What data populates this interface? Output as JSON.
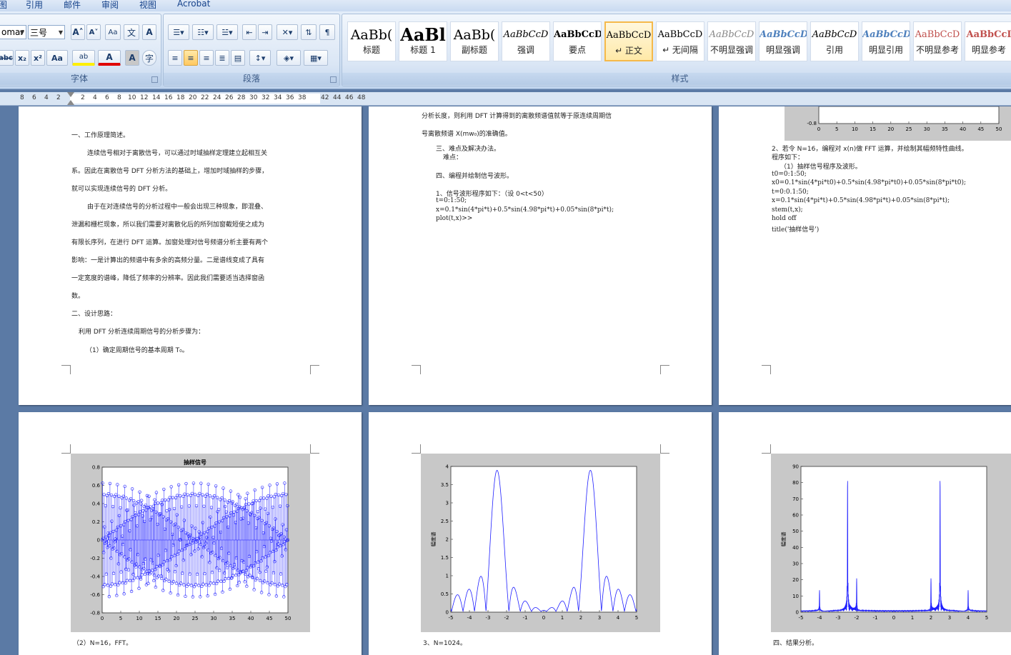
{
  "tabs": [
    "图",
    "引用",
    "邮件",
    "审阅",
    "视图",
    "Acrobat"
  ],
  "font_group": {
    "label": "字体",
    "font_name": "omar",
    "font_size": "三号",
    "grow": "A˄",
    "shrink": "A˅",
    "clear": "Aa",
    "phonetic": "文",
    "border_char": "A",
    "strike": "abc",
    "sub": "x₂",
    "sup": "x²",
    "case": "Aa",
    "highlight": "ab",
    "color": "A",
    "shade": "A",
    "enclose": "字"
  },
  "para_group": {
    "label": "段落"
  },
  "styles_group": {
    "label": "样式",
    "items": [
      {
        "sample": "AaBb(",
        "name": "标题",
        "size": 19,
        "weight": "normal",
        "color": "#000",
        "italic": false
      },
      {
        "sample": "AaBl",
        "name": "标题 1",
        "size": 24,
        "weight": "bold",
        "color": "#000",
        "italic": false
      },
      {
        "sample": "AaBb(",
        "name": "副标题",
        "size": 19,
        "weight": "normal",
        "color": "#000",
        "italic": false
      },
      {
        "sample": "AaBbCcD",
        "name": "强调",
        "size": 13,
        "weight": "normal",
        "color": "#000",
        "italic": true
      },
      {
        "sample": "AaBbCcD",
        "name": "要点",
        "size": 13,
        "weight": "bold",
        "color": "#000",
        "italic": false
      },
      {
        "sample": "AaBbCcD",
        "name": "↵ 正文",
        "size": 13,
        "weight": "normal",
        "color": "#000",
        "italic": false,
        "selected": true
      },
      {
        "sample": "AaBbCcD",
        "name": "↵ 无间隔",
        "size": 13,
        "weight": "normal",
        "color": "#000",
        "italic": false
      },
      {
        "sample": "AaBbCcD",
        "name": "不明显强调",
        "size": 13,
        "weight": "normal",
        "color": "#888",
        "italic": true
      },
      {
        "sample": "AaBbCcD",
        "name": "明显强调",
        "size": 13,
        "weight": "bold",
        "color": "#4f81bd",
        "italic": true
      },
      {
        "sample": "AaBbCcD",
        "name": "引用",
        "size": 13,
        "weight": "normal",
        "color": "#000",
        "italic": true
      },
      {
        "sample": "AaBbCcD",
        "name": "明显引用",
        "size": 13,
        "weight": "bold",
        "color": "#4f81bd",
        "italic": true
      },
      {
        "sample": "AaBbCcD",
        "name": "不明显参考",
        "size": 13,
        "weight": "normal",
        "color": "#c0504d",
        "italic": false
      },
      {
        "sample": "AaBbCcI",
        "name": "明显参考",
        "size": 13,
        "weight": "bold",
        "color": "#c0504d",
        "italic": false
      }
    ]
  },
  "ruler": {
    "numbers": [
      "8",
      "6",
      "4",
      "2",
      "2",
      "4",
      "6",
      "8",
      "10",
      "12",
      "14",
      "16",
      "18",
      "20",
      "22",
      "24",
      "26",
      "28",
      "30",
      "32",
      "34",
      "36",
      "38",
      "42",
      "44",
      "46",
      "48"
    ]
  },
  "page1": {
    "lines": [
      "一、工作原理简述。",
      "连续信号相对于离散信号，可以通过时域抽样定理建立起相互关",
      "系。因此在离散信号 DFT 分析方法的基础上，增加时域抽样的步骤，",
      "就可以实现连续信号的 DFT 分析。",
      "由于在对连续信号的分析过程中一般会出现三种现象，即混叠、",
      "泄漏和栅栏现象，所以我们需要对离散化后的所列加窗截短使之成为",
      "有限长序列，在进行 DFT 运算。加窗处理对信号频谱分析主要有两个",
      "影响：一是计算出的频谱中有多余的高频分量。二是谱线变成了具有",
      "一定宽度的谱峰，降低了频率的分辨率。因此我们需要适当选择窗函",
      "数。",
      "二、设计思路：",
      "利用 DFT 分析连续周期信号的分析步骤为：",
      "（1）确定周期信号的基本周期 T₀。"
    ]
  },
  "page2": {
    "lines": [
      "分析长度，则利用 DFT 计算得到的离散频谱值就等于原连续周期信",
      "号离散频谱 X(mw₀)的准确值。",
      "三、难点及解决办法。",
      "难点：",
      "四、编程并绘制信号波形。",
      "1、信号波形程序如下：（设 0<t<50）",
      "t=0:1:50;",
      "x=0.1*sin(4*pi*t)+0.5*sin(4.98*pi*t)+0.05*sin(8*pi*t);",
      "plot(t,x)>>"
    ]
  },
  "page3": {
    "lines": [
      "2、若令 N=16，编程对 x(n)做 FFT 运算，并绘制其幅频特性曲线。",
      "程序如下：",
      "（1）抽样信号程序及波形。",
      "t0=0:1:50;",
      "x0=0.1*sin(4*pi*t0)+0.5*sin(4.98*pi*t0)+0.05*sin(8*pi*t0);",
      "t=0:0.1:50;",
      "x=0.1*sin(4*pi*t)+0.5*sin(4.98*pi*t)+0.05*sin(8*pi*t);",
      "stem(t,x);",
      "hold off",
      "title('抽样信号')"
    ],
    "top_plot_x_ticks": [
      "0",
      "5",
      "10",
      "15",
      "20",
      "25",
      "30",
      "35",
      "40",
      "45",
      "50"
    ],
    "top_plot_y_label": "-0.8"
  },
  "page4": {
    "caption": "（2）N=16，FFT。"
  },
  "page5": {
    "caption": "3、N=1024。"
  },
  "page6": {
    "caption": "四、结果分析。"
  },
  "chart_data": [
    {
      "type": "scatter",
      "title": "抽样信号",
      "xlabel": "",
      "ylabel": "",
      "xlim": [
        0,
        50
      ],
      "ylim": [
        -0.8,
        0.8
      ],
      "x_ticks": [
        0,
        5,
        10,
        15,
        20,
        25,
        30,
        35,
        40,
        45,
        50
      ],
      "y_ticks": [
        -0.8,
        -0.6,
        -0.4,
        -0.2,
        0,
        0.2,
        0.4,
        0.6,
        0.8
      ],
      "series": [
        {
          "values": "x=0.1*sin(4*pi*t)+0.5*sin(4.98*pi*t)+0.05*sin(8*pi*t), t=0:0.1:50 (stem)"
        }
      ]
    },
    {
      "type": "line",
      "title": "",
      "xlabel": "",
      "ylabel": "幅度谱",
      "xlim": [
        -5,
        5
      ],
      "ylim": [
        0,
        4
      ],
      "x_ticks": [
        -5,
        -4,
        -3,
        -2,
        -1,
        0,
        1,
        2,
        3,
        4,
        5
      ],
      "y_ticks": [
        0,
        0.5,
        1,
        1.5,
        2,
        2.5,
        3,
        3.5,
        4
      ],
      "peaks": [
        {
          "x": -2.49,
          "y": 3.85
        },
        {
          "x": 2.49,
          "y": 3.85
        }
      ]
    },
    {
      "type": "line",
      "title": "",
      "xlabel": "",
      "ylabel": "幅度谱",
      "xlim": [
        -5,
        5
      ],
      "ylim": [
        0,
        90
      ],
      "x_ticks": [
        -5,
        -4,
        -3,
        -2,
        -1,
        0,
        1,
        2,
        3,
        4,
        5
      ],
      "y_ticks": [
        0,
        10,
        20,
        30,
        40,
        50,
        60,
        70,
        80,
        90
      ],
      "peaks": [
        {
          "x": -4,
          "y": 13
        },
        {
          "x": -2.49,
          "y": 83
        },
        {
          "x": -2,
          "y": 21
        },
        {
          "x": 2,
          "y": 21
        },
        {
          "x": 2.49,
          "y": 83
        },
        {
          "x": 4,
          "y": 13
        }
      ]
    }
  ]
}
